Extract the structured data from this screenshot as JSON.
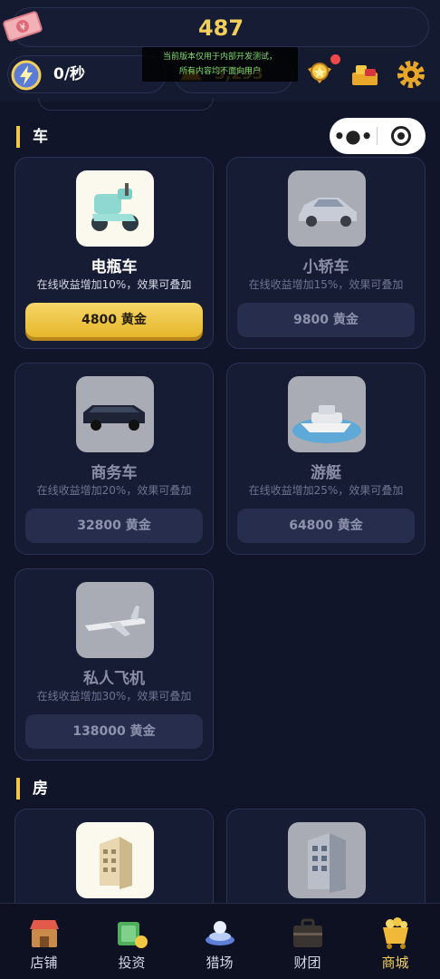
{
  "status": {
    "cash_value": "487",
    "income_rate": "0/秒",
    "gold_value": "3,293",
    "dev_notice_line1": "当前版本仅用于内部开发测试，",
    "dev_notice_line2": "所有内容均不面向用户",
    "icons": [
      "cash-icon",
      "lightning-icon",
      "gold-bar-icon",
      "medal-icon",
      "gift-icon",
      "gear-icon"
    ],
    "notification_color": "#ef4a4a"
  },
  "capsule": {
    "more_label": "•●•"
  },
  "sections": {
    "cars": {
      "title": "车"
    },
    "houses": {
      "title": "房"
    }
  },
  "items": [
    {
      "name": "电瓶车",
      "desc": "在线收益增加10%，效果可叠加",
      "price": "4800 黄金",
      "icon": "scooter-icon",
      "affordable": true
    },
    {
      "name": "小轿车",
      "desc": "在线收益增加15%，效果可叠加",
      "price": "9800 黄金",
      "icon": "sedan-icon",
      "affordable": false
    },
    {
      "name": "商务车",
      "desc": "在线收益增加20%，效果可叠加",
      "price": "32800 黄金",
      "icon": "limousine-icon",
      "affordable": false
    },
    {
      "name": "游艇",
      "desc": "在线收益增加25%，效果可叠加",
      "price": "64800 黄金",
      "icon": "yacht-icon",
      "affordable": false
    },
    {
      "name": "私人飞机",
      "desc": "在线收益增加30%，效果可叠加",
      "price": "138000 黄金",
      "icon": "private-jet-icon",
      "affordable": false
    }
  ],
  "house_items": [
    {
      "icon": "apartment-icon",
      "affordable": true
    },
    {
      "icon": "office-tower-icon",
      "affordable": false
    }
  ],
  "nav": [
    {
      "label": "店铺",
      "icon": "shop-icon"
    },
    {
      "label": "投资",
      "icon": "money-stack-icon"
    },
    {
      "label": "猎场",
      "icon": "arena-icon"
    },
    {
      "label": "财团",
      "icon": "briefcase-icon"
    },
    {
      "label": "商城",
      "icon": "gold-cart-icon",
      "current": true
    }
  ],
  "colors": {
    "accent_gold": "#f2cf5d",
    "background": "#10152a",
    "card": "#161c34"
  }
}
